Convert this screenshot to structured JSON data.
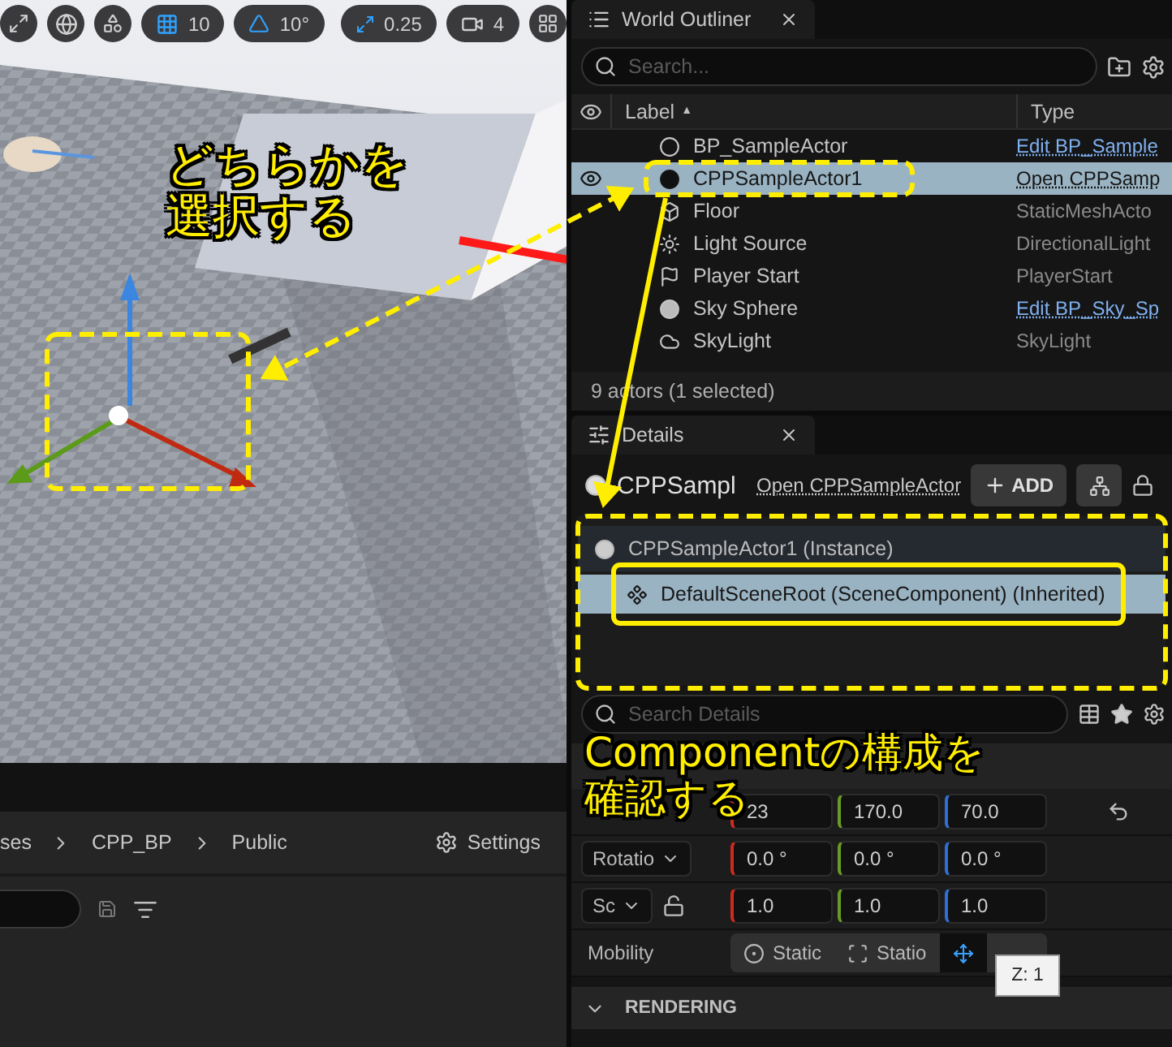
{
  "viewport": {
    "grid_snap": "10",
    "angle_snap": "10°",
    "scale_snap": "0.25",
    "camera_speed": "4"
  },
  "annotations": [
    {
      "lines": [
        "どちらかを",
        "選択する"
      ]
    },
    {
      "lines": [
        "Componentの構成を",
        "確認する"
      ]
    }
  ],
  "content_browser": {
    "breadcrumb": [
      "ses",
      "CPP_BP",
      "Public"
    ],
    "settings": "Settings"
  },
  "world_outliner": {
    "tab": "World Outliner",
    "search": {
      "placeholder": "Search..."
    },
    "columns": [
      {
        "label": "Label",
        "sort": "▲"
      },
      {
        "label": "Type"
      }
    ],
    "rows": [
      {
        "kind": "blueprint",
        "label": "BP_SampleActor",
        "type": "Edit BP_Sample",
        "type_is_link": true,
        "selected": false
      },
      {
        "kind": "actor",
        "label": "CPPSampleActor1",
        "type": "Open CPPSamp",
        "type_is_link": true,
        "selected": true
      },
      {
        "kind": "mesh",
        "label": "Floor",
        "type": "StaticMeshActo",
        "type_is_link": false,
        "selected": false
      },
      {
        "kind": "light",
        "label": "Light Source",
        "type": "DirectionalLight",
        "type_is_link": false,
        "selected": false
      },
      {
        "kind": "player_start",
        "label": "Player Start",
        "type": "PlayerStart",
        "type_is_link": false,
        "selected": false
      },
      {
        "kind": "sky_sphere",
        "label": "Sky Sphere",
        "type": "Edit BP_Sky_Sp",
        "type_is_link": true,
        "selected": false
      },
      {
        "kind": "sky_light",
        "label": "SkyLight",
        "type": "SkyLight",
        "type_is_link": false,
        "selected": false
      }
    ],
    "status": "9 actors (1 selected)"
  },
  "details": {
    "tab": "Details",
    "actor_name": "CPPSampl",
    "open_link": "Open CPPSampleActor",
    "add_button": "ADD",
    "components": [
      {
        "label": "CPPSampleActor1 (Instance)",
        "selected": false,
        "children": [
          {
            "label": "DefaultSceneRoot (SceneComponent) (Inherited)",
            "selected": true
          }
        ]
      }
    ],
    "search": {
      "placeholder": "Search Details"
    },
    "transform": [
      {
        "values": [
          "23",
          "170.0",
          "70.0"
        ],
        "reset": true
      },
      {
        "dropdown": "Rotatio",
        "values": [
          "0.0 °",
          "0.0 °",
          "0.0 °"
        ],
        "reset": false
      },
      {
        "dropdown": "Sc",
        "locked": false,
        "values": [
          "1.0",
          "1.0",
          "1.0"
        ],
        "reset": false
      }
    ],
    "tooltip": "Z: 1",
    "mobility": {
      "label": "Mobility",
      "options": [
        {
          "kind": "static",
          "label": "Static",
          "selected": false
        },
        {
          "kind": "stationary",
          "label": "Statio",
          "selected": false
        },
        {
          "kind": "movable",
          "selected": true
        }
      ]
    },
    "section": "RENDERING"
  }
}
